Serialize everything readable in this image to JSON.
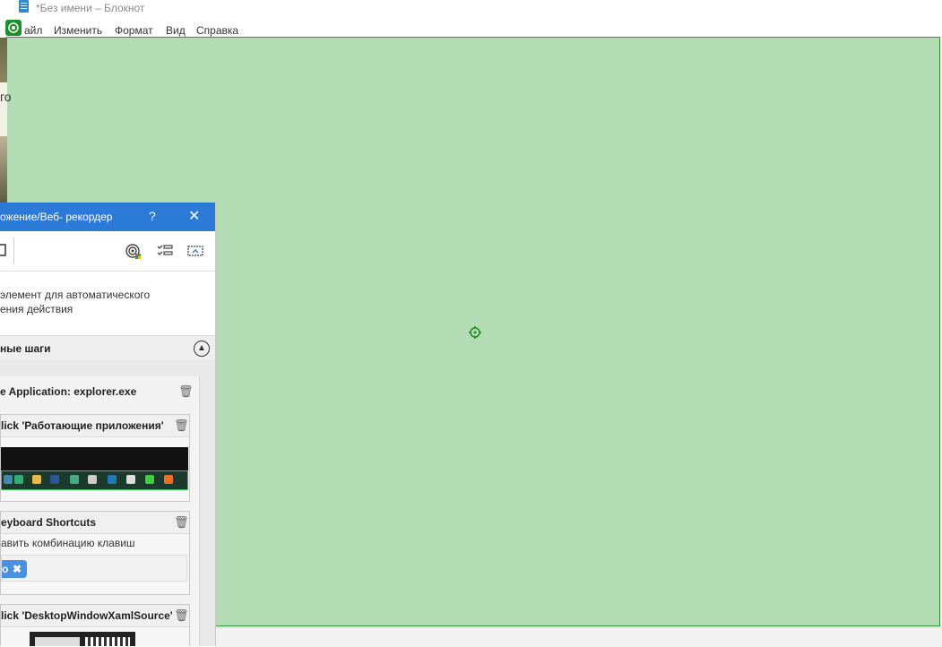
{
  "notepad": {
    "title": "*Без имени – Блокнот",
    "menu": [
      "айл",
      "Изменить",
      "Формат",
      "Вид",
      "Справка"
    ]
  },
  "background": {
    "fragment_text": "го"
  },
  "recorder": {
    "title": "ожение/Веб- рекордер",
    "help": "?",
    "close": "✕",
    "hint_line1": "элемент для автоматического",
    "hint_line2": "ения действия",
    "section_title": "ные шаги",
    "steps": [
      {
        "title": "e Application: explorer.exe"
      },
      {
        "title": "lick 'Работающие приложения'"
      },
      {
        "title": "eyboard Shortcuts",
        "subtitle": "авить комбинацию клавиш",
        "chip_label": "o"
      },
      {
        "title": "lick 'DesktopWindowXamlSource'"
      }
    ]
  },
  "colors": {
    "accent": "#2b7ad8",
    "highlight_fill": "#b4dcb4",
    "highlight_border": "#2a9a2a"
  }
}
